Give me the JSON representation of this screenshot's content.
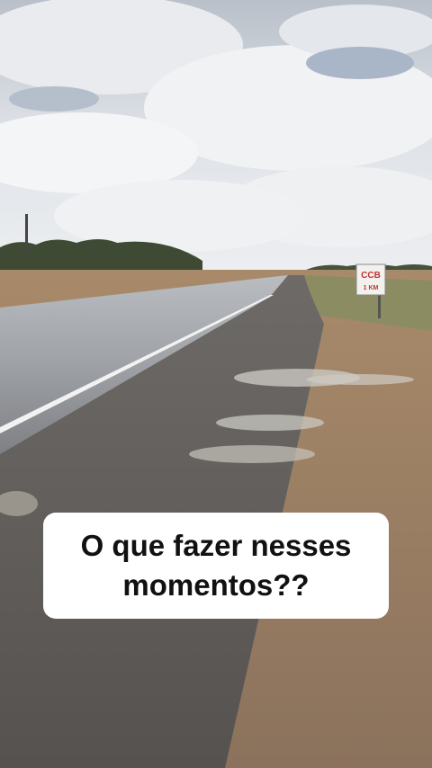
{
  "caption": {
    "line1": "O que fazer nesses",
    "line2": "momentos??"
  },
  "sign": {
    "text": "CCB",
    "subtext": "1 KM"
  },
  "colors": {
    "sky_top": "#c9ced6",
    "cloud": "#eef0f2",
    "road": "#5c5a58",
    "dirt": "#9a7f62",
    "caption_bg": "#ffffff",
    "caption_text": "#111111"
  }
}
